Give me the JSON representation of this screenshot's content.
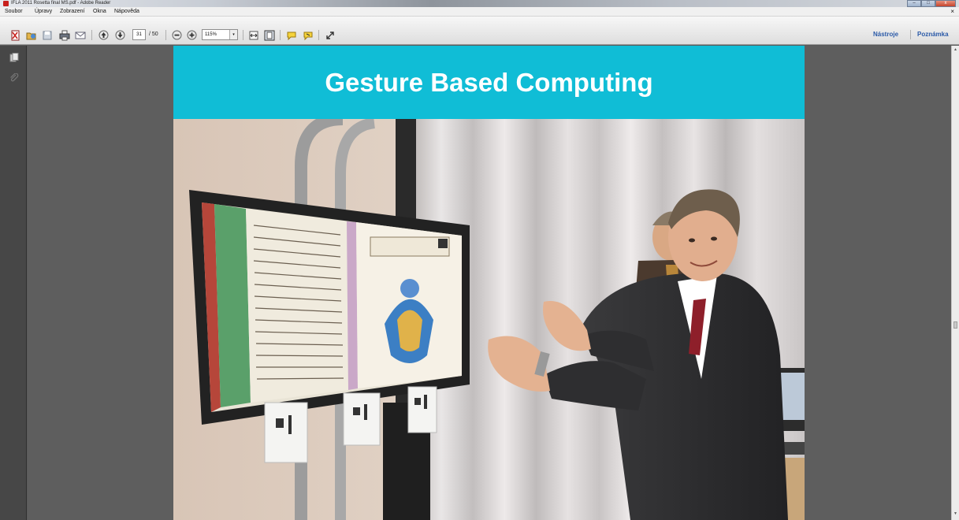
{
  "window": {
    "title": "IFLA 2011 Rosetta final MS.pdf - Adobe Reader",
    "minimize_glyph": "–",
    "maximize_glyph": "□",
    "close_glyph": "x"
  },
  "menu": {
    "items": [
      "Soubor",
      "Úpravy",
      "Zobrazení",
      "Okna",
      "Nápověda"
    ],
    "close_glyph": "×"
  },
  "toolbar": {
    "current_page": "31",
    "total_pages": "/ 50",
    "zoom": "115%",
    "zoom_caret": "▾",
    "right_links": [
      "Nástroje",
      "Poznámka"
    ]
  },
  "slide": {
    "title": "Gesture Based Computing"
  },
  "icons": {
    "toolbar": [
      "create-pdf-icon",
      "open-icon",
      "save-icon",
      "print-icon",
      "email-icon",
      "previous-page-icon",
      "next-page-icon",
      "zoom-out-icon",
      "zoom-in-icon",
      "fit-width-icon",
      "fit-page-icon",
      "comment-icon",
      "highlight-icon",
      "expand-icon"
    ],
    "left_panel": [
      "pages-icon",
      "attachments-icon"
    ]
  },
  "colors": {
    "slide_header": "#10bdd6",
    "link_blue": "#2b5aa8"
  }
}
